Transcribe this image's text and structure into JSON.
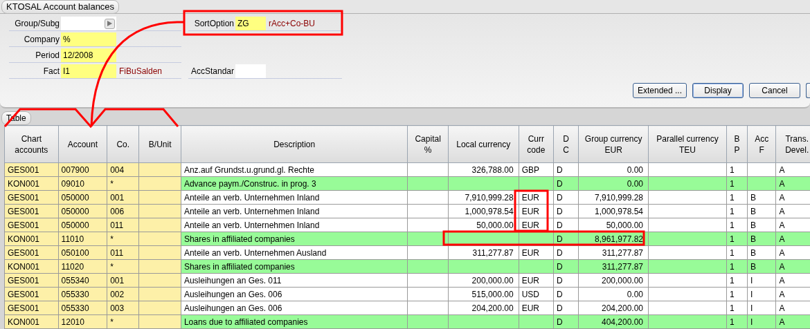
{
  "window": {
    "title": "KTOSAL Account balances"
  },
  "form_rows": [
    [
      {
        "label": "Group/Subg",
        "kind": "picker",
        "mandatory": false
      },
      {
        "label": "SortOption",
        "kind": "text",
        "value": "ZG",
        "mandatory": true,
        "description": "rAcc+Co-BU"
      }
    ],
    [
      {
        "label": "Company",
        "kind": "text",
        "value": "%",
        "mandatory": true
      }
    ],
    [
      {
        "label": "Period",
        "kind": "text",
        "value": "12/2008",
        "mandatory": true
      }
    ],
    [
      {
        "label": "Fact",
        "kind": "text",
        "value": "I1",
        "mandatory": true,
        "description": "FiBuSalden"
      },
      {
        "label": "AccStandar",
        "kind": "text",
        "mandatory": false
      }
    ]
  ],
  "buttons": [
    {
      "label": "Extended ...",
      "focused": false
    },
    {
      "label": "Display",
      "focused": true
    },
    {
      "label": "Cancel",
      "focused": false
    }
  ],
  "table": {
    "tab": "Table",
    "columns": [
      {
        "label": "Chart\naccounts",
        "kind": "key"
      },
      {
        "label": "Account",
        "kind": "key"
      },
      {
        "label": "Co.",
        "kind": "key"
      },
      {
        "label": "B/Unit",
        "kind": "key"
      },
      {
        "label": "Description",
        "kind": "text"
      },
      {
        "label": "Capital\n%",
        "kind": "text"
      },
      {
        "label": "Local currency",
        "kind": "amount"
      },
      {
        "label": "Curr\ncode",
        "kind": "text"
      },
      {
        "label": "D\nC",
        "kind": "text"
      },
      {
        "label": "Group currency\nEUR",
        "kind": "amount"
      },
      {
        "label": "Parallel currency\nTEU",
        "kind": "amount"
      },
      {
        "label": "B\nP",
        "kind": "text"
      },
      {
        "label": "Acc\nF",
        "kind": "text"
      },
      {
        "label": "Trans.\nDevel.",
        "kind": "text"
      }
    ],
    "rows": [
      {
        "kind": "detail",
        "cells": [
          "GES001",
          "007900",
          "004",
          null,
          "Anz.auf Grundst.u.grund.gl. Rechte",
          null,
          "326,788.00",
          "GBP",
          "D",
          "0.00",
          null,
          "1",
          null,
          "A"
        ]
      },
      {
        "kind": "total",
        "cells": [
          "KON001",
          "09010",
          "*",
          null,
          "Advance paym./Construc. in prog. 3",
          null,
          null,
          null,
          "D",
          "0.00",
          null,
          "1",
          null,
          "A"
        ]
      },
      {
        "kind": "detail",
        "cells": [
          "GES001",
          "050000",
          "001",
          null,
          "Anteile an verb. Unternehmen Inland",
          null,
          "7,910,999.28",
          "EUR",
          "D",
          "7,910,999.28",
          null,
          "1",
          "B",
          "A"
        ]
      },
      {
        "kind": "detail",
        "cells": [
          "GES001",
          "050000",
          "006",
          null,
          "Anteile an verb. Unternehmen Inland",
          null,
          "1,000,978.54",
          "EUR",
          "D",
          "1,000,978.54",
          null,
          "1",
          "B",
          "A"
        ]
      },
      {
        "kind": "detail",
        "cells": [
          "GES001",
          "050000",
          "011",
          null,
          "Anteile an verb. Unternehmen Inland",
          null,
          "50,000.00",
          "EUR",
          "D",
          "50,000.00",
          null,
          "1",
          "B",
          "A"
        ]
      },
      {
        "kind": "total",
        "cells": [
          "KON001",
          "11010",
          "*",
          null,
          "Shares in affiliated companies",
          null,
          null,
          null,
          "D",
          "8,961,977.82",
          null,
          "1",
          "B",
          "A"
        ]
      },
      {
        "kind": "detail",
        "cells": [
          "GES001",
          "050100",
          "011",
          null,
          "Anteile an verb. Unternehmen Ausland",
          null,
          "311,277.87",
          "EUR",
          "D",
          "311,277.87",
          null,
          "1",
          "B",
          "A"
        ]
      },
      {
        "kind": "total",
        "cells": [
          "KON001",
          "11020",
          "*",
          null,
          "Shares in affiliated companies",
          null,
          null,
          null,
          "D",
          "311,277.87",
          null,
          "1",
          "B",
          "A"
        ]
      },
      {
        "kind": "detail",
        "cells": [
          "GES001",
          "055340",
          "001",
          null,
          "Ausleihungen an Ges. 011",
          null,
          "200,000.00",
          "EUR",
          "D",
          "200,000.00",
          null,
          "1",
          "I",
          "A"
        ]
      },
      {
        "kind": "detail",
        "cells": [
          "GES001",
          "055330",
          "002",
          null,
          "Ausleihungen an Ges. 006",
          null,
          "515,000.00",
          "USD",
          "D",
          "0.00",
          null,
          "1",
          "I",
          "A"
        ]
      },
      {
        "kind": "detail",
        "cells": [
          "GES001",
          "055330",
          "003",
          null,
          "Ausleihungen an Ges. 006",
          null,
          "204,200.00",
          "EUR",
          "D",
          "204,200.00",
          null,
          "1",
          "I",
          "A"
        ]
      },
      {
        "kind": "total",
        "cells": [
          "KON001",
          "12010",
          "*",
          null,
          "Loans due to affiliated companies",
          null,
          null,
          null,
          "D",
          "404,200.00",
          null,
          "1",
          "I",
          "A"
        ]
      }
    ]
  }
}
